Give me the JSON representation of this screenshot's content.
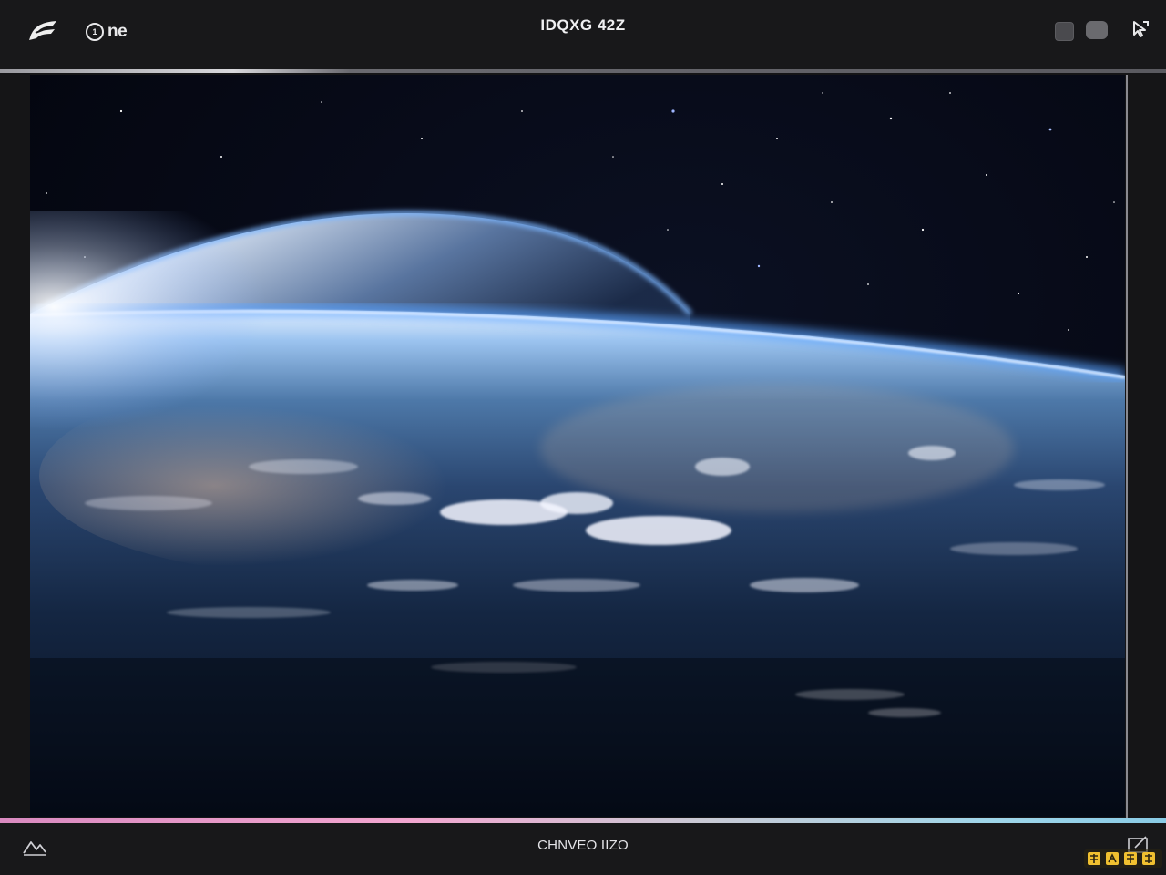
{
  "header": {
    "brand_text": "ne",
    "brand_badge": "1",
    "title": "IDQXG 42Z"
  },
  "footer": {
    "caption": "CHNVEO IIZO"
  },
  "icons": {
    "logo": "logo-icon",
    "window_a": "square-icon",
    "window_b": "rounded-square-icon",
    "pointer": "cursor-icon",
    "bottom_left": "chart-icon",
    "bottom_right": "edit-icon"
  },
  "colors": {
    "bar_background": "#18181a",
    "text": "#e8e8ea",
    "atmosphere": "#5aa0ff",
    "space": "#05070f"
  }
}
